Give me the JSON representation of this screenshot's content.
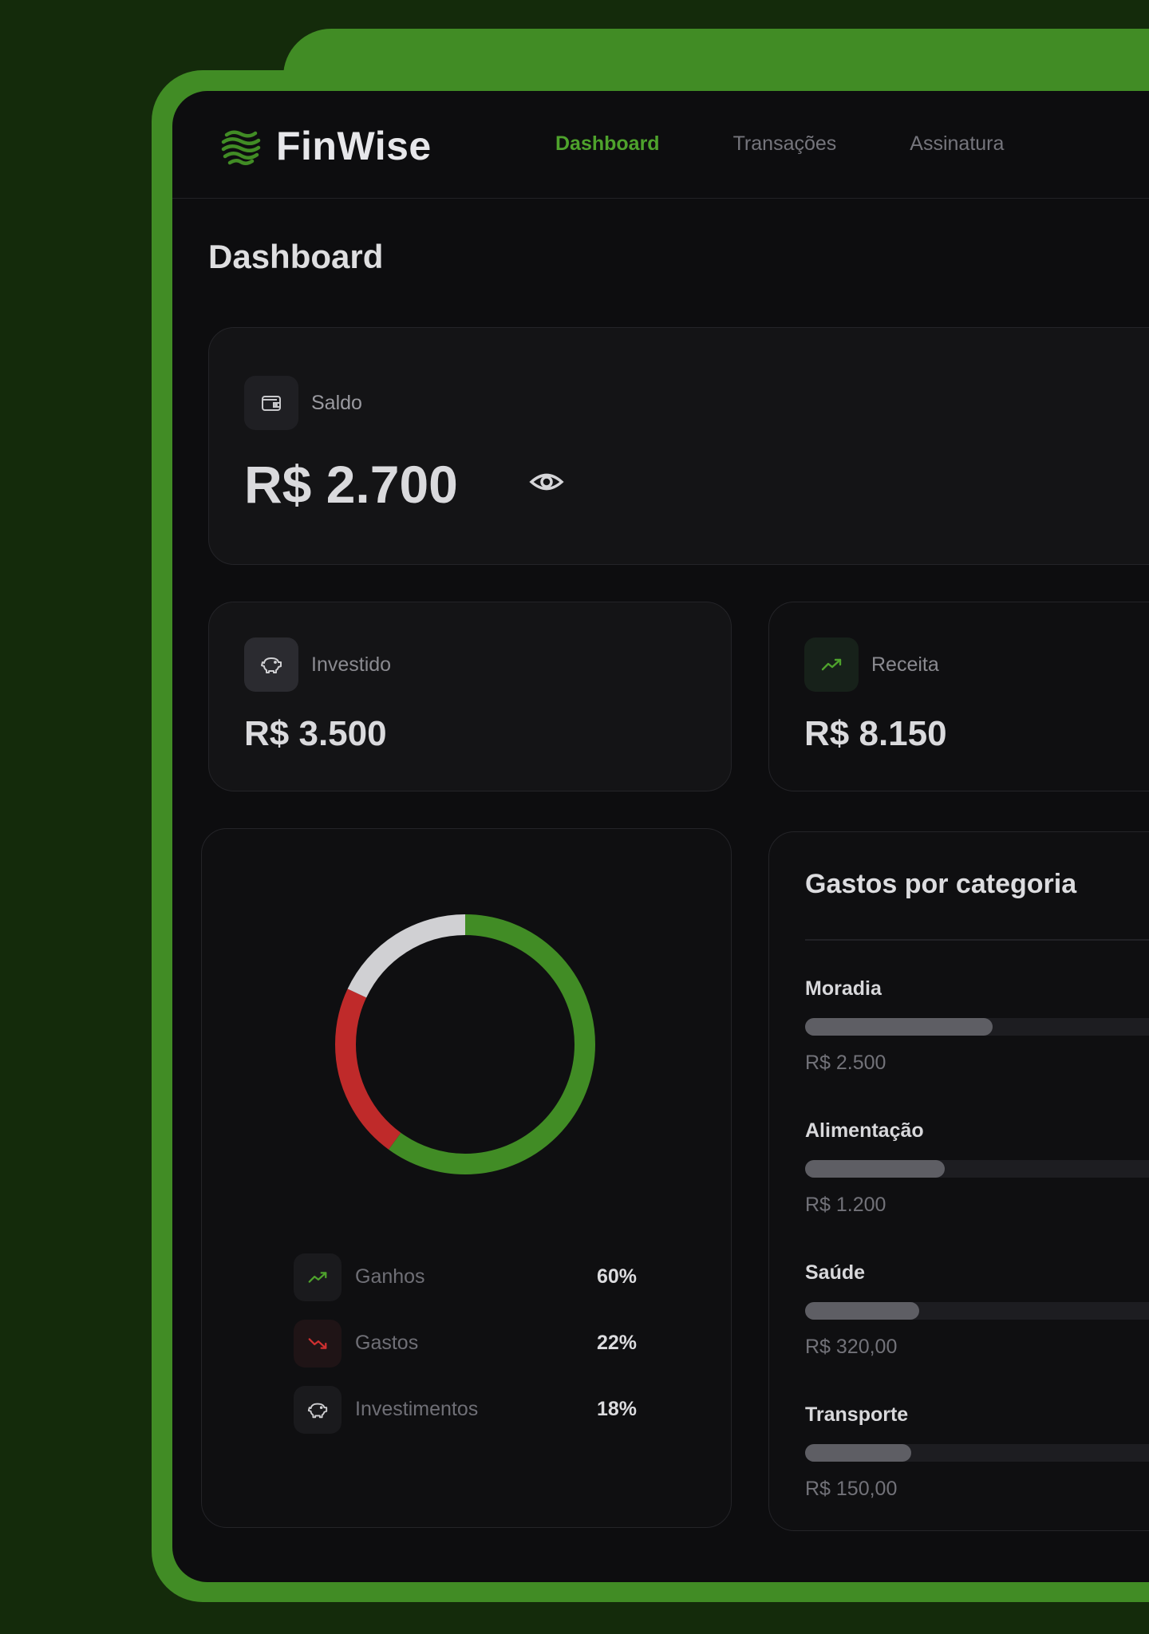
{
  "app": {
    "name": "FinWise"
  },
  "nav": {
    "links": [
      {
        "label": "Dashboard",
        "active": true
      },
      {
        "label": "Transações",
        "active": false
      },
      {
        "label": "Assinatura",
        "active": false
      }
    ]
  },
  "page": {
    "title": "Dashboard"
  },
  "cards": {
    "saldo": {
      "label": "Saldo",
      "value": "R$ 2.700",
      "icon": "wallet-icon",
      "toggle_icon": "eye-icon"
    },
    "investido": {
      "label": "Investido",
      "value": "R$ 3.500",
      "icon": "piggy-bank-icon"
    },
    "receita": {
      "label": "Receita",
      "value": "R$ 8.150",
      "icon": "trending-up-icon"
    }
  },
  "chart_data": {
    "type": "pie",
    "categories": [
      "Ganhos",
      "Gastos",
      "Investimentos"
    ],
    "values": [
      60,
      22,
      18
    ],
    "colors": [
      "#418c25",
      "#bf2a2a",
      "#d0d0d3"
    ],
    "legend_placement": "bottom",
    "display_values": [
      "60%",
      "22%",
      "18%"
    ]
  },
  "legend": [
    {
      "label": "Ganhos",
      "value": "60%",
      "icon": "trending-up-icon"
    },
    {
      "label": "Gastos",
      "value": "22%",
      "icon": "trending-down-icon"
    },
    {
      "label": "Investimentos",
      "value": "18%",
      "icon": "piggy-bank-icon"
    }
  ],
  "categories_card": {
    "title": "Gastos por categoria",
    "items": [
      {
        "name": "Moradia",
        "amount": "R$ 2.500",
        "fraction": 0.51
      },
      {
        "name": "Alimentação",
        "amount": "R$ 1.200",
        "fraction": 0.38
      },
      {
        "name": "Saúde",
        "amount": "R$ 320,00",
        "fraction": 0.31
      },
      {
        "name": "Transporte",
        "amount": "R$ 150,00",
        "fraction": 0.29
      }
    ]
  },
  "colors": {
    "brand_green": "#418c25",
    "accent_green": "#4ea22c",
    "loss_red": "#bf2a2a",
    "background": "#142b0b"
  }
}
